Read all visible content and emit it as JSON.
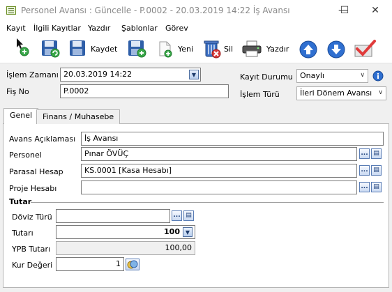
{
  "window": {
    "title": "Personel Avansı : Güncelle - P.0002 - 20.03.2019 14:22 İş Avansı",
    "minimize_glyph": "—",
    "maximize_glyph": "☐",
    "close_glyph": "✕"
  },
  "menu": [
    "Kayıt",
    "İlgili Kayıtlar",
    "Yazdır",
    "Şablonlar",
    "Görev"
  ],
  "toolbar": {
    "save_label": "Kaydet",
    "new_label": "Yeni",
    "delete_label": "Sil",
    "print_label": "Yazdır"
  },
  "header": {
    "islem_zamani_label": "İşlem Zamanı",
    "islem_zamani_value": "20.03.2019 14:22",
    "fis_no_label": "Fiş No",
    "fis_no_value": "P.0002",
    "kayit_durumu_label": "Kayıt Durumu",
    "kayit_durumu_value": "Onaylı",
    "islem_turu_label": "İşlem Türü",
    "islem_turu_value": "İleri Dönem Avansı"
  },
  "tabs": [
    {
      "label": "Genel",
      "active": true
    },
    {
      "label": "Finans / Muhasebe",
      "active": false
    }
  ],
  "genel": {
    "avans_aciklamasi_label": "Avans Açıklaması",
    "avans_aciklamasi_value": "İş Avansı",
    "personel_label": "Personel",
    "personel_value": "Pınar ÖVÜÇ",
    "parasal_hesap_label": "Parasal Hesap",
    "parasal_hesap_value": "KS.0001 [Kasa Hesabı]",
    "proje_hesabi_label": "Proje Hesabı",
    "proje_hesabi_value": "",
    "lookup_glyph": "...",
    "card_glyph": "▤"
  },
  "tutar": {
    "section_title": "Tutar",
    "doviz_turu_label": "Döviz Türü",
    "doviz_turu_value": "",
    "tutari_label": "Tutarı",
    "tutari_value": "100",
    "ypb_tutari_label": "YPB Tutarı",
    "ypb_tutari_value": "100,00",
    "kur_degeri_label": "Kur Değeri",
    "kur_degeri_value": "1"
  },
  "colors": {
    "accent_blue": "#2f6fd0",
    "toolbar_green": "#3aa84a",
    "delete_red": "#d93a3a"
  }
}
